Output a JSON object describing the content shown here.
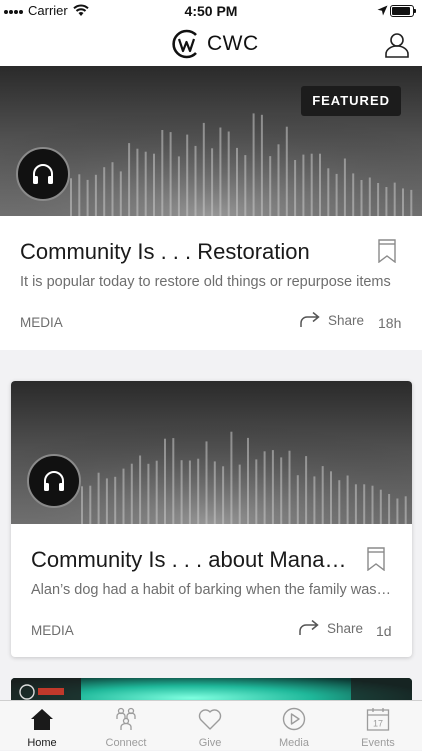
{
  "status_bar": {
    "carrier": "Carrier",
    "time": "4:50 PM"
  },
  "nav": {
    "logo_text": "CWC"
  },
  "feed": {
    "items": [
      {
        "badge": "FEATURED",
        "title": "Community Is . . . Restoration",
        "description": "It is popular today to restore old things or repurpose items",
        "category": "MEDIA",
        "share_label": "Share",
        "time_ago": "18h"
      },
      {
        "title": "Community Is . . . about Managing",
        "description": "Alan’s dog had a habit of barking when the family was away",
        "category": "MEDIA",
        "share_label": "Share",
        "time_ago": "1d"
      }
    ]
  },
  "tabs": [
    {
      "label": "Home",
      "icon": "home-icon",
      "active": true
    },
    {
      "label": "Connect",
      "icon": "people-icon",
      "active": false
    },
    {
      "label": "Give",
      "icon": "heart-icon",
      "active": false
    },
    {
      "label": "Media",
      "icon": "play-icon",
      "active": false
    },
    {
      "label": "Events",
      "icon": "calendar-icon",
      "active": false
    }
  ],
  "calendar_icon_day": "17",
  "colors": {
    "accent": "#1a1a1a",
    "inactive": "#9c9c9c",
    "badge_bg": "#1c1c1c"
  }
}
